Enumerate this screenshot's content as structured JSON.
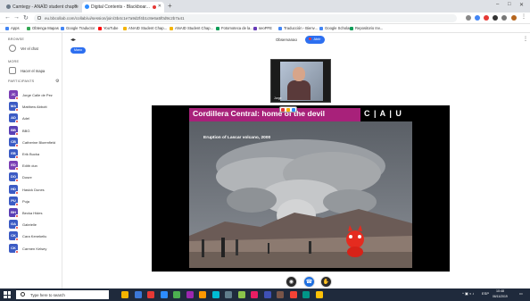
{
  "browser": {
    "tabs": [
      {
        "label": "Camtegy - ANAÏD student chapte",
        "active": false
      },
      {
        "label": "Digital Contents - Blackboar...",
        "active": true
      }
    ],
    "new_tab": "+",
    "window_controls": [
      "–",
      "□",
      "✕"
    ],
    "address": "eu.bbcollab.com/collab/ui/session/join/3b4c1e7a9d2f4b1c8e6a5f0d9c2b7a41",
    "bookmarks": [
      {
        "label": "Apps",
        "color": "#4285f4"
      },
      {
        "label": "Obtenga Mapas",
        "color": "#34a853"
      },
      {
        "label": "Google Traductor",
        "color": "#4285f4"
      },
      {
        "label": "YouTube",
        "color": "#ff0000"
      },
      {
        "label": "ANAID Student Chap...",
        "color": "#f4b400"
      },
      {
        "label": "ANAID Student Chap...",
        "color": "#f4b400"
      },
      {
        "label": "Fotomoteca de la...",
        "color": "#0f9d58"
      },
      {
        "label": "seoPFE",
        "color": "#673ab7"
      },
      {
        "label": "Traducción - Bienv...",
        "color": "#4285f4"
      },
      {
        "label": "Google Scholar",
        "color": "#4285f4"
      },
      {
        "label": "Repositorio Inv...",
        "color": "#0f9d58"
      }
    ]
  },
  "sidebar": {
    "search_section_title": "BROWSE",
    "search_label": "Ver el chat",
    "actions_section_title": "MORE",
    "actions_label": "Hacer el mapa",
    "participants_section_title": "PARTICIPANTS",
    "participants": [
      {
        "name": "Jorge Calle de Pez",
        "initials": "JC",
        "color": "#7b3fb5"
      },
      {
        "name": "Matthew Abbott",
        "initials": "MA",
        "color": "#3c5bc4"
      },
      {
        "name": "Adel",
        "initials": "AD",
        "color": "#3c5bc4"
      },
      {
        "name": "BBG",
        "initials": "BB",
        "color": "#5a3fb5"
      },
      {
        "name": "Catherine Bloemfield",
        "initials": "CB",
        "color": "#3c5bc4"
      },
      {
        "name": "Erik Bucka",
        "initials": "EB",
        "color": "#3c5bc4"
      },
      {
        "name": "Edith dun",
        "initials": "ED",
        "color": "#7b3fb5"
      },
      {
        "name": "Dosre",
        "initials": "DO",
        "color": "#3c5bc4"
      },
      {
        "name": "Hasick Dunes",
        "initials": "HD",
        "color": "#3c5bc4"
      },
      {
        "name": "Puja",
        "initials": "PU",
        "color": "#3c5bc4"
      },
      {
        "name": "Becka Hides",
        "initials": "BH",
        "color": "#5a3fb5"
      },
      {
        "name": "Gabrielle",
        "initials": "GA",
        "color": "#3c5bc4"
      },
      {
        "name": "Cara Kenekeliu",
        "initials": "CK",
        "color": "#3c5bc4"
      },
      {
        "name": "Carmen Kelsey",
        "initials": "CK",
        "color": "#3c5bc4"
      }
    ],
    "add_button": "+"
  },
  "session": {
    "raise_hand_label": "Mano",
    "call_title": "Observanao",
    "recording_label": "Abrir",
    "more": "⋮",
    "webcam_name": "Jorge"
  },
  "slide": {
    "title": "Cordillera Central: home of the devil",
    "logo": "C | A | U",
    "caption": "Eruption of Lascar volcano,  2000"
  },
  "controls": {
    "mic": "🎤",
    "camera": "📷",
    "hand": "✋"
  },
  "taskbar": {
    "search_placeholder": "Type here to search",
    "apps": [
      "#f4b400",
      "#3c78d8",
      "#e53935",
      "#2d8cff",
      "#4caf50",
      "#9c27b0",
      "#ff9800",
      "#00bcd4",
      "#607d8b",
      "#8bc34a",
      "#e91e63",
      "#3f51b5",
      "#795548",
      "#f44336",
      "#009688",
      "#ffc107"
    ],
    "time": "10:48",
    "date": "06/11/2019",
    "lang": "ESP"
  }
}
